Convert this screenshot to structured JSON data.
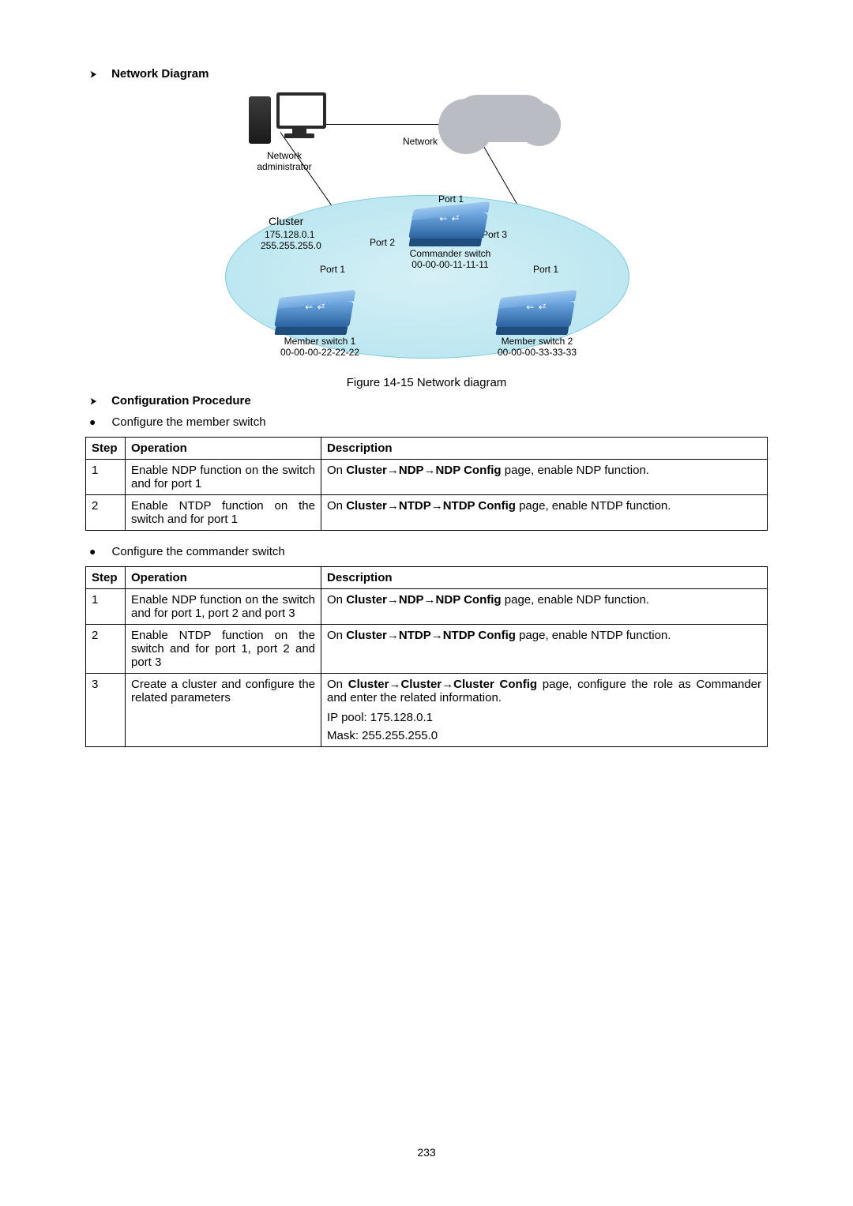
{
  "sections": {
    "network_diagram_heading": "Network Diagram",
    "config_procedure_heading": "Configuration Procedure"
  },
  "diagram": {
    "pc_label_line1": "Network",
    "pc_label_line2": "administrator",
    "cloud_label": "Network",
    "cluster_title": "Cluster",
    "cluster_ip": "175.128.0.1",
    "cluster_mask": "255.255.255.0",
    "port1_top": "Port 1",
    "port2": "Port 2",
    "port3": "Port 3",
    "port1_left": "Port 1",
    "port1_right": "Port 1",
    "commander_label_line1": "Commander switch",
    "commander_mac": "00-00-00-11-11-11",
    "member1_label": "Member switch 1",
    "member1_mac": "00-00-00-22-22-22",
    "member2_label": "Member switch 2",
    "member2_mac": "00-00-00-33-33-33"
  },
  "figure_caption": "Figure 14-15 Network diagram",
  "bullets": {
    "member_switch": "Configure the member switch",
    "commander_switch": "Configure the commander switch"
  },
  "table_headers": {
    "step": "Step",
    "operation": "Operation",
    "description": "Description"
  },
  "member_table": [
    {
      "step": "1",
      "operation": "Enable NDP function on the switch and for port 1",
      "desc_pre": "On ",
      "desc_bold": "Cluster→NDP→NDP Config",
      "desc_post": " page, enable NDP function."
    },
    {
      "step": "2",
      "operation": "Enable NTDP function on the switch and for port 1",
      "desc_pre": "On ",
      "desc_bold": "Cluster→NTDP→NTDP Config",
      "desc_post": " page, enable NTDP function."
    }
  ],
  "commander_table": [
    {
      "step": "1",
      "operation": "Enable NDP function on the switch and for port 1, port 2 and port 3",
      "desc_pre": "On ",
      "desc_bold": "Cluster→NDP→NDP Config",
      "desc_post": " page, enable NDP function."
    },
    {
      "step": "2",
      "operation": "Enable NTDP function on the switch and for port 1, port 2 and port 3",
      "desc_pre": "On ",
      "desc_bold": "Cluster→NTDP→NTDP Config",
      "desc_post": " page, enable NTDP function."
    },
    {
      "step": "3",
      "operation": "Create a cluster and configure the related parameters",
      "desc_pre": "On ",
      "desc_bold": "Cluster→Cluster→Cluster Config",
      "desc_post": " page, configure the role as Commander and enter the related information.",
      "line2": "IP pool: 175.128.0.1",
      "line3": "Mask: 255.255.255.0"
    }
  ],
  "page_number": "233"
}
